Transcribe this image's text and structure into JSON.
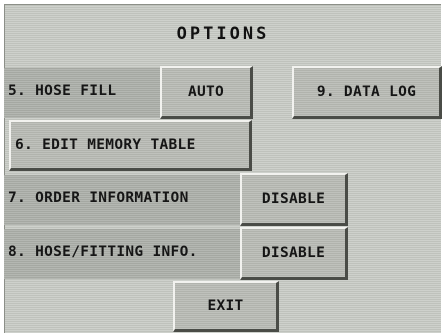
{
  "screen": {
    "title": "OPTIONS"
  },
  "rows": {
    "hose_fill_label": "5. HOSE FILL",
    "hose_fill_button": "AUTO",
    "data_log_button": "9. DATA LOG",
    "edit_memory_table_button": "6. EDIT MEMORY TABLE",
    "order_information_label": "7. ORDER INFORMATION",
    "order_information_button": "DISABLE",
    "hose_fitting_label": "8. HOSE/FITTING INFO.",
    "hose_fitting_button": "DISABLE"
  },
  "footer": {
    "exit_button": "EXIT"
  },
  "colors": {
    "panel": "#c9ccc6",
    "band": "#aeb1ab",
    "button": "#b8bab4",
    "bevel_light": "#f2f2ef",
    "bevel_dark": "#4a4c47",
    "text": "#141414"
  }
}
